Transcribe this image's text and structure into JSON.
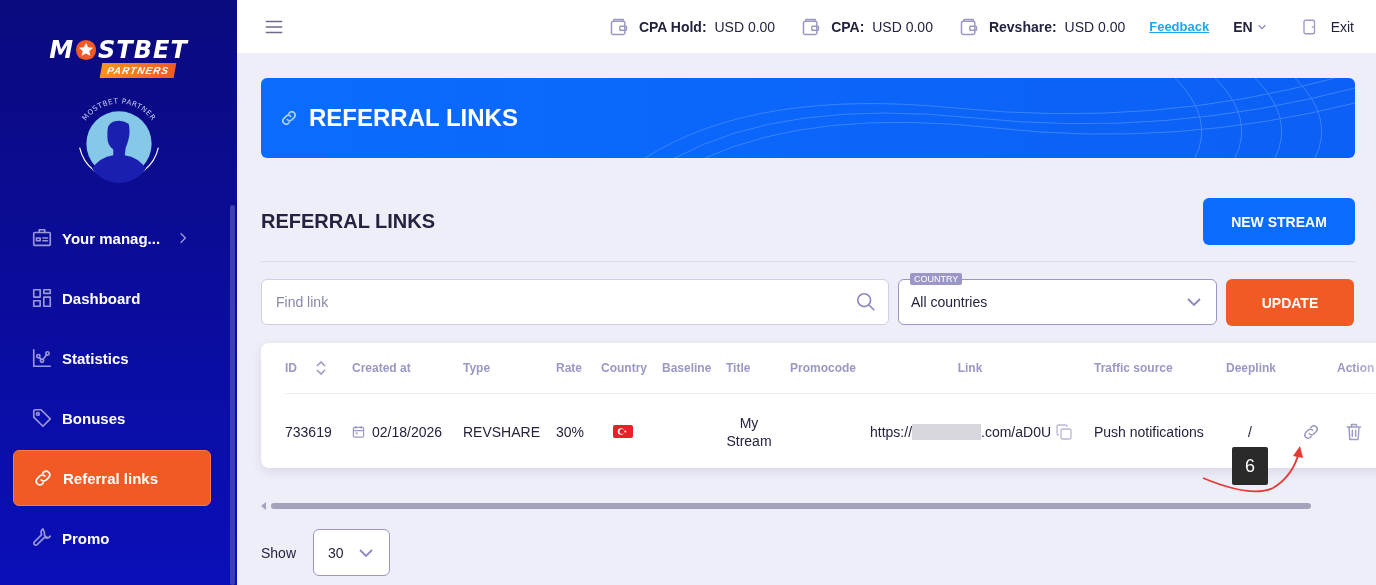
{
  "sidebar": {
    "logo": {
      "left": "M",
      "right": "STBET",
      "badge": "PARTNERS"
    },
    "avatar_caption": "MOSTBET PARTNER",
    "items": [
      {
        "label": "Your manag...",
        "selected": false,
        "expandable": true
      },
      {
        "label": "Dashboard",
        "selected": false,
        "expandable": false
      },
      {
        "label": "Statistics",
        "selected": false,
        "expandable": false
      },
      {
        "label": "Bonuses",
        "selected": false,
        "expandable": false
      },
      {
        "label": "Referral links",
        "selected": true,
        "expandable": false
      },
      {
        "label": "Promo",
        "selected": false,
        "expandable": false
      }
    ]
  },
  "top_bar": {
    "balances": [
      {
        "label": "CPA Hold:",
        "value": "USD 0.00"
      },
      {
        "label": "CPA:",
        "value": "USD 0.00"
      },
      {
        "label": "Revshare:",
        "value": "USD 0.00"
      }
    ],
    "feedback": "Feedback",
    "language": "EN",
    "exit": "Exit"
  },
  "banner": {
    "title": "REFERRAL LINKS"
  },
  "section": {
    "title": "REFERRAL LINKS",
    "new_stream": "NEW STREAM"
  },
  "filters": {
    "search": {
      "placeholder": "Find link"
    },
    "country": {
      "label": "COUNTRY",
      "value": "All countries"
    },
    "update": "UPDATE"
  },
  "table": {
    "columns": [
      {
        "label": "ID",
        "sortable": true
      },
      {
        "label": "Created at"
      },
      {
        "label": "Type"
      },
      {
        "label": "Rate"
      },
      {
        "label": "Country"
      },
      {
        "label": "Baseline"
      },
      {
        "label": "Title"
      },
      {
        "label": "Promocode"
      },
      {
        "label": "Link"
      },
      {
        "label": "Traffic source"
      },
      {
        "label": "Deeplink"
      },
      {
        "label": "Action"
      }
    ],
    "rows": [
      {
        "id": "733619",
        "created_at": "02/18/2026",
        "type": "REVSHARE",
        "rate": "30%",
        "title": "My Stream",
        "link_prefix": "https://",
        "link_suffix": ".com/aD0U",
        "traffic_source": "Push notifications",
        "deeplink": "/"
      }
    ]
  },
  "annotation": {
    "label": "6"
  },
  "pagination": {
    "label": "Show",
    "value": "30"
  }
}
